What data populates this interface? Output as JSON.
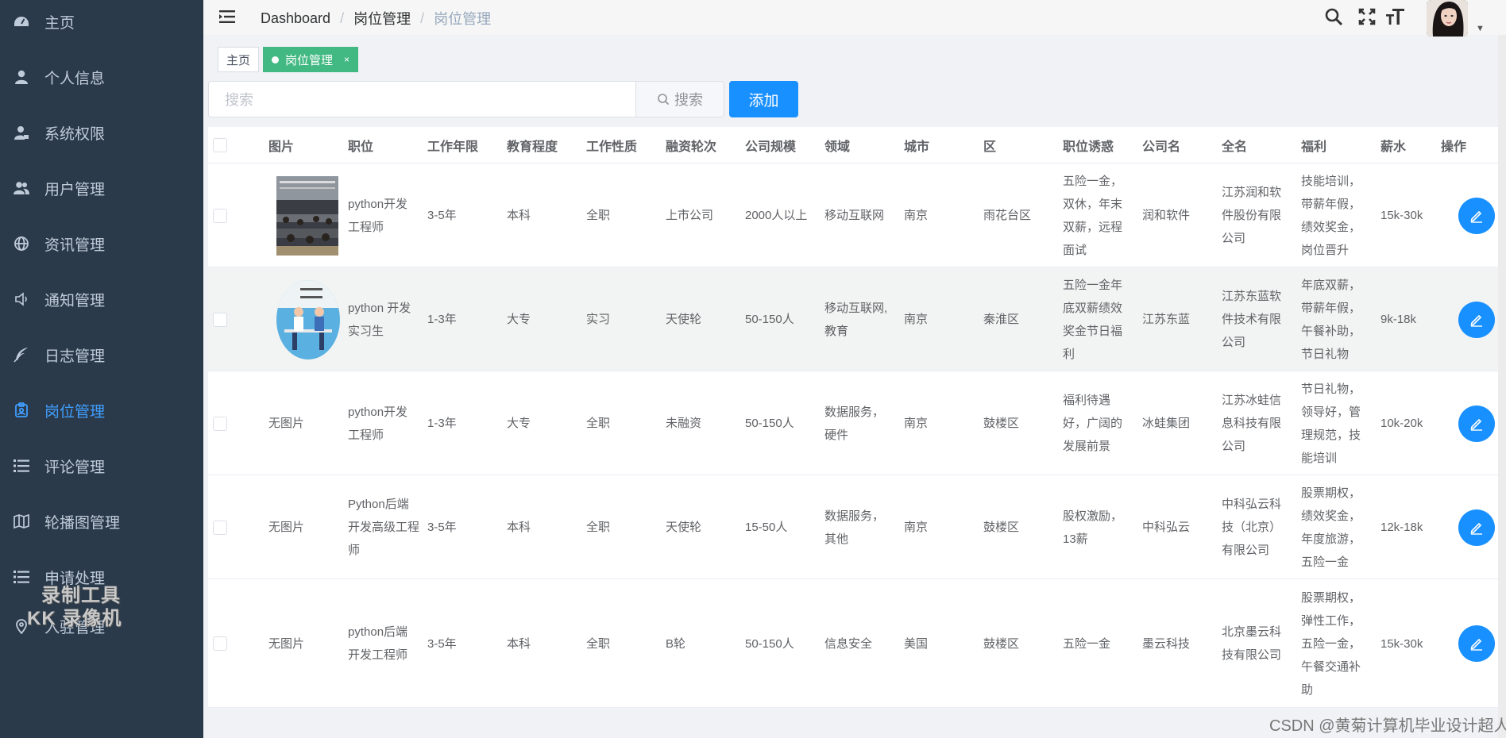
{
  "sidebar": {
    "items": [
      {
        "label": "主页",
        "icon": "dashboard-icon"
      },
      {
        "label": "个人信息",
        "icon": "user-icon"
      },
      {
        "label": "系统权限",
        "icon": "user-lock-icon"
      },
      {
        "label": "用户管理",
        "icon": "users-icon"
      },
      {
        "label": "资讯管理",
        "icon": "globe-icon"
      },
      {
        "label": "通知管理",
        "icon": "speaker-icon"
      },
      {
        "label": "日志管理",
        "icon": "feather-icon"
      },
      {
        "label": "岗位管理",
        "icon": "badge-icon",
        "active": true
      },
      {
        "label": "评论管理",
        "icon": "list-icon"
      },
      {
        "label": "轮播图管理",
        "icon": "map-icon"
      },
      {
        "label": "申请处理",
        "icon": "list-icon"
      },
      {
        "label": "入驻管理",
        "icon": "location-icon"
      }
    ],
    "recorder_watermark": [
      "录制工具",
      "KK 录像机"
    ]
  },
  "navbar": {
    "breadcrumb": [
      "Dashboard",
      "岗位管理",
      "岗位管理"
    ]
  },
  "tags": [
    {
      "label": "主页",
      "active": false
    },
    {
      "label": "岗位管理",
      "active": true,
      "close": "×"
    }
  ],
  "search": {
    "placeholder": "搜索",
    "button_label": "搜索",
    "add_label": "添加"
  },
  "table": {
    "headers": [
      "图片",
      "职位",
      "工作年限",
      "教育程度",
      "工作性质",
      "融资轮次",
      "公司规模",
      "领域",
      "城市",
      "区",
      "职位诱惑",
      "公司名",
      "全名",
      "福利",
      "薪水",
      "操作"
    ],
    "rows": [
      {
        "image": "photo-office",
        "title": "python开发工程师",
        "years": "3-5年",
        "education": "本科",
        "nature": "全职",
        "funding": "上市公司",
        "size": "2000人以上",
        "field": "移动互联网",
        "city": "南京",
        "district": "雨花台区",
        "perks": "五险一金，双休，年末双薪，远程面试",
        "company": "润和软件",
        "fullname": "江苏润和软件股份有限公司",
        "welfare": "技能培训，带薪年假，绩效奖金，岗位晋升",
        "salary": "15k-30k"
      },
      {
        "image": "photo-illustration",
        "title": "python 开发实习生",
        "years": "1-3年",
        "education": "大专",
        "nature": "实习",
        "funding": "天使轮",
        "size": "50-150人",
        "field": "移动互联网,教育",
        "city": "南京",
        "district": "秦淮区",
        "perks": "五险一金年底双薪绩效奖金节日福利",
        "company": "江苏东蓝",
        "fullname": "江苏东蓝软件技术有限公司",
        "welfare": "年底双薪，带薪年假，午餐补助，节日礼物",
        "salary": "9k-18k"
      },
      {
        "image": "无图片",
        "title": "python开发工程师",
        "years": "1-3年",
        "education": "大专",
        "nature": "全职",
        "funding": "未融资",
        "size": "50-150人",
        "field": "数据服务，硬件",
        "city": "南京",
        "district": "鼓楼区",
        "perks": "福利待遇好，广阔的发展前景",
        "company": "冰蛙集团",
        "fullname": "江苏冰蛙信息科技有限公司",
        "welfare": "节日礼物，领导好，管理规范，技能培训",
        "salary": "10k-20k"
      },
      {
        "image": "无图片",
        "title": "Python后端开发高级工程师",
        "years": "3-5年",
        "education": "本科",
        "nature": "全职",
        "funding": "天使轮",
        "size": "15-50人",
        "field": "数据服务，其他",
        "city": "南京",
        "district": "鼓楼区",
        "perks": "股权激励，13薪",
        "company": "中科弘云",
        "fullname": "中科弘云科技（北京）有限公司",
        "welfare": "股票期权，绩效奖金，年度旅游，五险一金",
        "salary": "12k-18k"
      },
      {
        "image": "无图片",
        "title": "python后端开发工程师",
        "years": "3-5年",
        "education": "本科",
        "nature": "全职",
        "funding": "B轮",
        "size": "50-150人",
        "field": "信息安全",
        "city": "美国",
        "district": "鼓楼区",
        "perks": "五险一金",
        "company": "墨云科技",
        "fullname": "北京墨云科技有限公司",
        "welfare": "股票期权，弹性工作，五险一金，午餐交通补助",
        "salary": "15k-30k"
      }
    ]
  },
  "footer_watermark": "CSDN @黄菊计算机毕业设计超人",
  "colors": {
    "sidebar_bg": "#2b3a4a",
    "active": "#409eff",
    "primary_button": "#1890ff",
    "tag_active": "#42b983"
  }
}
